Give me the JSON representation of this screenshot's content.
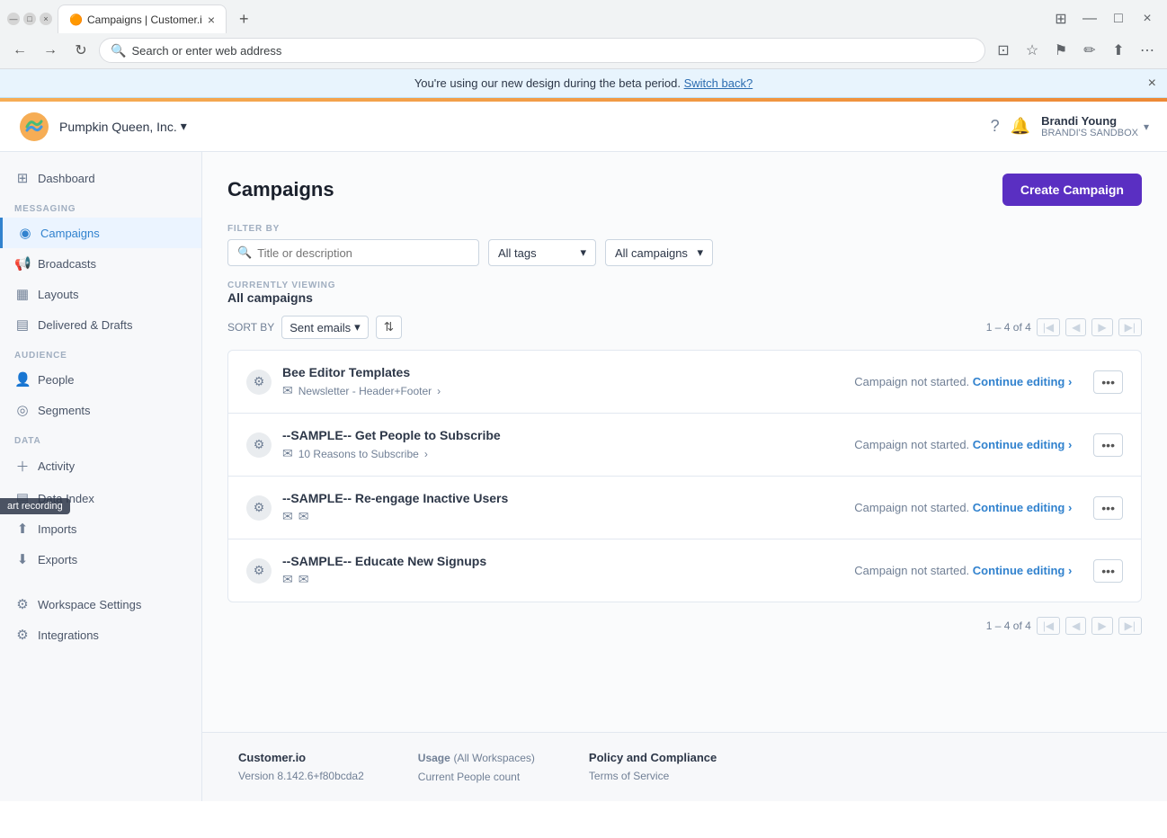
{
  "browser": {
    "tab_title": "Campaigns | Customer.i",
    "address": "Search or enter web address",
    "favicon": "🟠"
  },
  "banner": {
    "text": "You're using our new design during the beta period.",
    "link_text": "Switch back?",
    "close_label": "×"
  },
  "header": {
    "company": "Pumpkin Queen, Inc.",
    "chevron": "▾",
    "user_name": "Brandi Young",
    "user_workspace": "BRANDI'S SANDBOX"
  },
  "sidebar": {
    "dashboard_label": "Dashboard",
    "messaging_section": "MESSAGING",
    "campaigns_label": "Campaigns",
    "broadcasts_label": "Broadcasts",
    "layouts_label": "Layouts",
    "delivered_drafts_label": "Delivered & Drafts",
    "audience_section": "AUDIENCE",
    "people_label": "People",
    "segments_label": "Segments",
    "data_section": "DATA",
    "activity_label": "Activity",
    "data_index_label": "Data Index",
    "imports_label": "Imports",
    "exports_label": "Exports",
    "workspace_settings_label": "Workspace Settings",
    "integrations_label": "Integrations"
  },
  "main": {
    "page_title": "Campaigns",
    "create_btn": "Create Campaign",
    "filter_label": "FILTER BY",
    "filter_placeholder": "Title or description",
    "tags_default": "All tags",
    "campaigns_default": "All campaigns",
    "currently_viewing_label": "CURRENTLY VIEWING",
    "currently_viewing_value": "All campaigns",
    "sort_by_label": "SORT BY",
    "sort_option": "Sent emails",
    "pagination_text": "1 – 4 of 4",
    "pagination_text_bottom": "1 – 4 of 4",
    "campaigns": [
      {
        "id": 1,
        "name": "Bee Editor Templates",
        "sub_label": "Newsletter - Header+Footer",
        "sub_arrow": "›",
        "status_text": "Campaign not started.",
        "status_link": "Continue editing",
        "status_arrow": "›",
        "emails": 1
      },
      {
        "id": 2,
        "name": "--SAMPLE-- Get People to Subscribe",
        "sub_label": "10 Reasons to Subscribe",
        "sub_arrow": "›",
        "status_text": "Campaign not started.",
        "status_link": "Continue editing",
        "status_arrow": "›",
        "emails": 1
      },
      {
        "id": 3,
        "name": "--SAMPLE-- Re-engage Inactive Users",
        "sub_label": "",
        "sub_arrow": "",
        "status_text": "Campaign not started.",
        "status_link": "Continue editing",
        "status_arrow": "›",
        "emails": 2
      },
      {
        "id": 4,
        "name": "--SAMPLE-- Educate New Signups",
        "sub_label": "",
        "sub_arrow": "",
        "status_text": "Campaign not started.",
        "status_link": "Continue editing",
        "status_arrow": "›",
        "emails": 2
      }
    ]
  },
  "footer": {
    "col1_title": "Customer.io",
    "col1_version": "Version 8.142.6+f80bcda2",
    "col2_title": "Usage",
    "col2_subtitle": "(All Workspaces)",
    "col2_metric": "Current People count",
    "col3_title": "Policy and Compliance",
    "col3_link": "Terms of Service"
  }
}
